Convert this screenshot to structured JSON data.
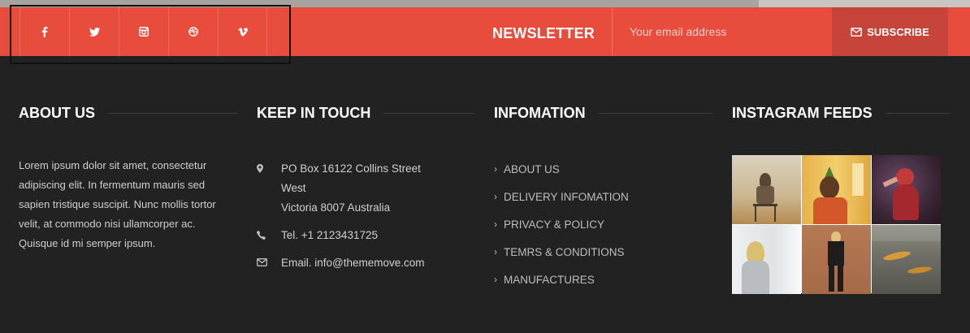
{
  "social": {
    "icons": [
      "facebook-icon",
      "twitter-icon",
      "instagram-icon",
      "dribbble-icon",
      "vimeo-icon"
    ]
  },
  "newsletter": {
    "title": "NEWSLETTER",
    "email_placeholder": "Your email address",
    "subscribe_label": "SUBSCRIBE"
  },
  "about": {
    "title": "ABOUT US",
    "text": "Lorem ipsum dolor sit amet, consectetur adipiscing elit. In fermentum mauris sed sapien tristique suscipit. Nunc mollis tortor velit, at commodo nisi ullamcorper ac. Quisque id mi semper ipsum."
  },
  "contact": {
    "title": "KEEP IN TOUCH",
    "address_line1": "PO Box 16122 Collins Street",
    "address_line2": "West",
    "address_line3": "Victoria 8007 Australia",
    "phone": "Tel. +1 2123431725",
    "email": "Email. info@thememove.com"
  },
  "info": {
    "title": "INFOMATION",
    "links": [
      "ABOUT US",
      "DELIVERY INFOMATION",
      "PRIVACY & POLICY",
      "TEMRS & CONDITIONS",
      "MANUFACTURES"
    ]
  },
  "instagram": {
    "title": "INSTAGRAM FEEDS"
  },
  "colors": {
    "accent": "#e74c3c",
    "footer_bg": "#222222"
  }
}
